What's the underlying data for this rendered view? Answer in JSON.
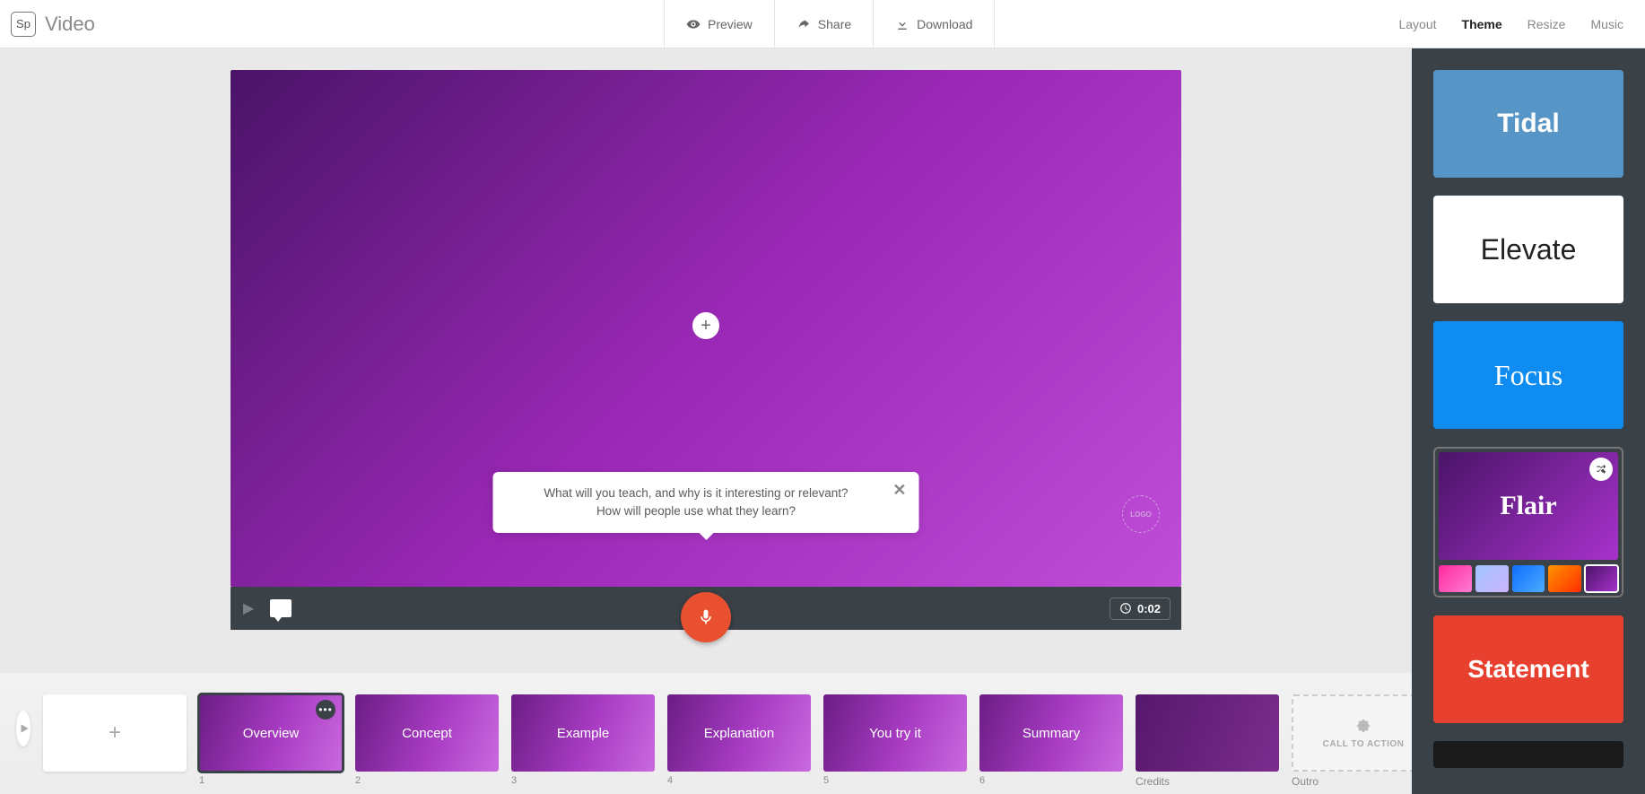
{
  "brand": {
    "badge": "Sp",
    "title": "Video"
  },
  "header": {
    "preview": "Preview",
    "share": "Share",
    "download": "Download",
    "tabs": {
      "layout": "Layout",
      "theme": "Theme",
      "resize": "Resize",
      "music": "Music"
    }
  },
  "canvas": {
    "logo": "LOGO",
    "tooltip_l1": "What will you teach, and why is it interesting or relevant?",
    "tooltip_l2": "How will people use what they learn?",
    "time": "0:02"
  },
  "slides": {
    "s1": {
      "label": "Overview",
      "num": "1"
    },
    "s2": {
      "label": "Concept",
      "num": "2"
    },
    "s3": {
      "label": "Example",
      "num": "3"
    },
    "s4": {
      "label": "Explanation",
      "num": "4"
    },
    "s5": {
      "label": "You try it",
      "num": "5"
    },
    "s6": {
      "label": "Summary",
      "num": "6"
    },
    "credits": "Credits",
    "cta": "CALL TO ACTION",
    "outro": "Outro"
  },
  "themes": {
    "tidal": "Tidal",
    "elevate": "Elevate",
    "focus": "Focus",
    "flair": "Flair",
    "statement": "Statement"
  },
  "swatches": [
    "linear-gradient(135deg,#ff2a9d,#ff7bd1)",
    "linear-gradient(135deg,#a0c4ff,#cdb4ff)",
    "linear-gradient(135deg,#0d6efd,#4dabff)",
    "linear-gradient(135deg,#ff9500,#ff2d00)",
    "linear-gradient(135deg,#4a1468,#a832cc)"
  ]
}
